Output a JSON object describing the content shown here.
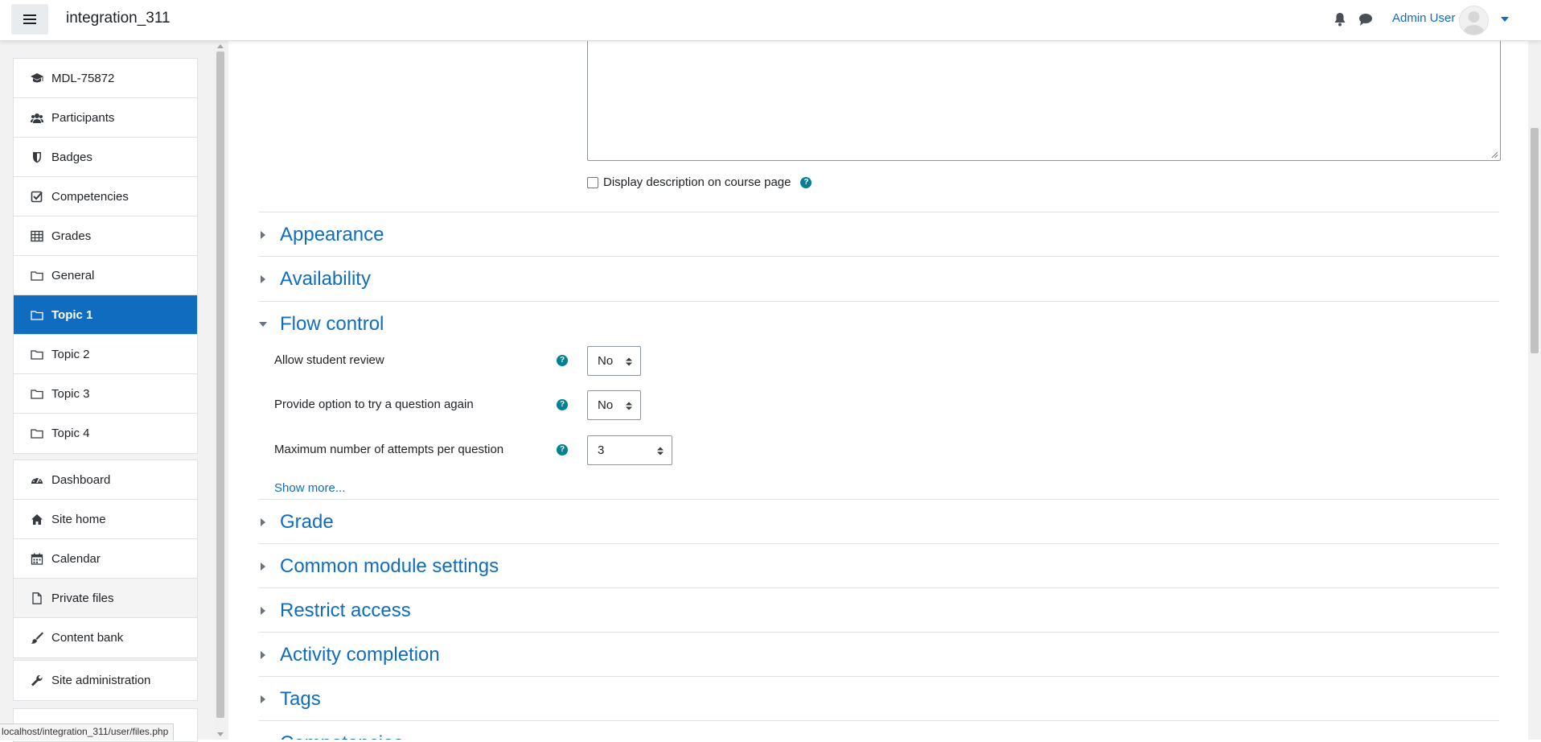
{
  "navbar": {
    "site_name": "integration_311",
    "user_name": "Admin User"
  },
  "sidebar": {
    "course_items": [
      {
        "label": "MDL-75872",
        "icon": "graduation-cap-icon"
      },
      {
        "label": "Participants",
        "icon": "users-icon"
      },
      {
        "label": "Badges",
        "icon": "shield-icon"
      },
      {
        "label": "Competencies",
        "icon": "check-square-icon"
      },
      {
        "label": "Grades",
        "icon": "table-icon"
      },
      {
        "label": "General",
        "icon": "folder-icon"
      },
      {
        "label": "Topic 1",
        "icon": "folder-icon"
      },
      {
        "label": "Topic 2",
        "icon": "folder-icon"
      },
      {
        "label": "Topic 3",
        "icon": "folder-icon"
      },
      {
        "label": "Topic 4",
        "icon": "folder-icon"
      }
    ],
    "site_items": [
      {
        "label": "Dashboard",
        "icon": "tachometer-icon"
      },
      {
        "label": "Site home",
        "icon": "home-icon"
      },
      {
        "label": "Calendar",
        "icon": "calendar-icon"
      },
      {
        "label": "Private files",
        "icon": "file-icon"
      },
      {
        "label": "Content bank",
        "icon": "paint-brush-icon"
      }
    ],
    "admin_items": [
      {
        "label": "Site administration",
        "icon": "wrench-icon"
      }
    ]
  },
  "status_url": "localhost/integration_311/user/files.php",
  "form": {
    "display_description_label": "Display description on course page",
    "sections": {
      "appearance": "Appearance",
      "availability": "Availability",
      "flow_control": "Flow control",
      "grade": "Grade",
      "common_module": "Common module settings",
      "restrict_access": "Restrict access",
      "activity_completion": "Activity completion",
      "tags": "Tags",
      "competencies": "Competencies"
    },
    "flow_control": {
      "allow_review_label": "Allow student review",
      "allow_review_value": "No",
      "try_again_label": "Provide option to try a question again",
      "try_again_value": "No",
      "max_attempts_label": "Maximum number of attempts per question",
      "max_attempts_value": "3"
    },
    "show_more": "Show more..."
  },
  "colors": {
    "primary": "#0f6cbf",
    "help": "#008196"
  }
}
